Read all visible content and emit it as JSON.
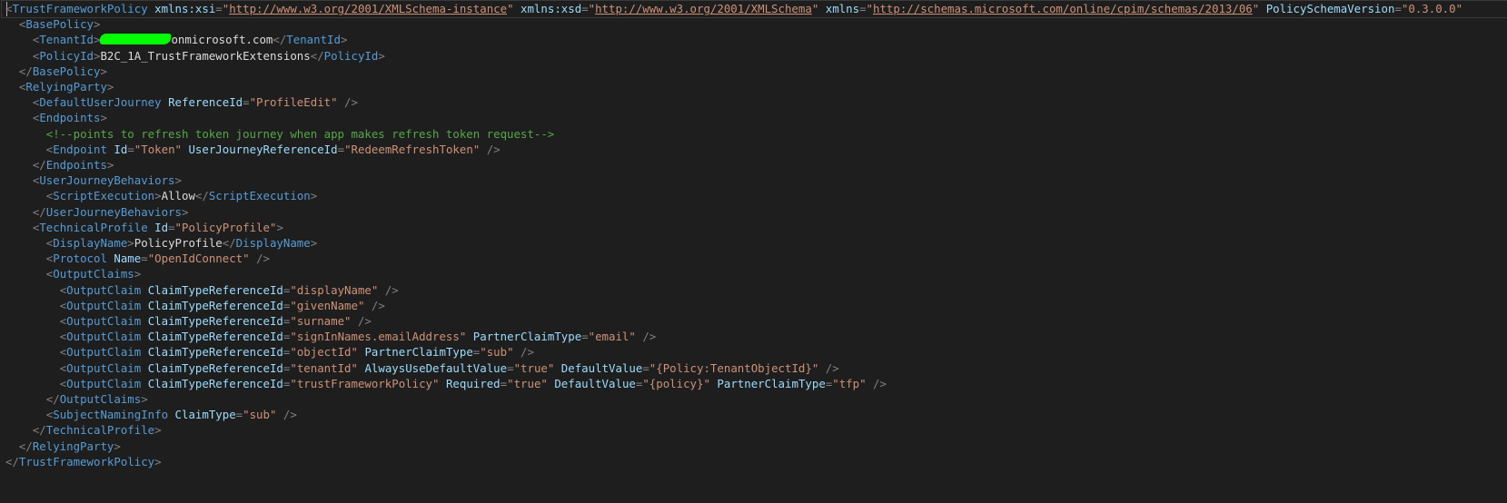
{
  "colors": {
    "background": "#1e1e1e",
    "tag": "#569cd6",
    "punctuation": "#808080",
    "attribute": "#9cdcfe",
    "string": "#ce9178",
    "text": "#dcdcdc",
    "comment": "#57a64a",
    "redaction": "#00ff00"
  },
  "lines": [
    {
      "indent": 0,
      "tokens": [
        {
          "t": "punc",
          "v": "<"
        },
        {
          "t": "tag",
          "v": "TrustFrameworkPolicy"
        },
        {
          "t": "text",
          "v": " "
        },
        {
          "t": "attr",
          "v": "xmlns:xsi"
        },
        {
          "t": "punc",
          "v": "="
        },
        {
          "t": "str",
          "v": "\""
        },
        {
          "t": "link",
          "v": "http://www.w3.org/2001/XMLSchema-instance"
        },
        {
          "t": "str",
          "v": "\""
        },
        {
          "t": "text",
          "v": " "
        },
        {
          "t": "attr",
          "v": "xmlns:xsd"
        },
        {
          "t": "punc",
          "v": "="
        },
        {
          "t": "str",
          "v": "\""
        },
        {
          "t": "link",
          "v": "http://www.w3.org/2001/XMLSchema"
        },
        {
          "t": "str",
          "v": "\""
        },
        {
          "t": "text",
          "v": " "
        },
        {
          "t": "attr",
          "v": "xmlns"
        },
        {
          "t": "punc",
          "v": "="
        },
        {
          "t": "str",
          "v": "\""
        },
        {
          "t": "link",
          "v": "http://schemas.microsoft.com/online/cpim/schemas/2013/06"
        },
        {
          "t": "str",
          "v": "\""
        },
        {
          "t": "text",
          "v": " "
        },
        {
          "t": "attr",
          "v": "PolicySchemaVersion"
        },
        {
          "t": "punc",
          "v": "="
        },
        {
          "t": "str",
          "v": "\"0.3.0.0\""
        }
      ]
    },
    {
      "indent": 1,
      "tokens": [
        {
          "t": "punc",
          "v": "<"
        },
        {
          "t": "tag",
          "v": "BasePolicy"
        },
        {
          "t": "punc",
          "v": ">"
        }
      ]
    },
    {
      "indent": 2,
      "tokens": [
        {
          "t": "punc",
          "v": "<"
        },
        {
          "t": "tag",
          "v": "TenantId"
        },
        {
          "t": "punc",
          "v": ">"
        },
        {
          "t": "redacted",
          "v": ""
        },
        {
          "t": "text",
          "v": "onmicrosoft.com"
        },
        {
          "t": "punc",
          "v": "</"
        },
        {
          "t": "tag",
          "v": "TenantId"
        },
        {
          "t": "punc",
          "v": ">"
        }
      ]
    },
    {
      "indent": 2,
      "tokens": [
        {
          "t": "punc",
          "v": "<"
        },
        {
          "t": "tag",
          "v": "PolicyId"
        },
        {
          "t": "punc",
          "v": ">"
        },
        {
          "t": "text",
          "v": "B2C_1A_TrustFrameworkExtensions"
        },
        {
          "t": "punc",
          "v": "</"
        },
        {
          "t": "tag",
          "v": "PolicyId"
        },
        {
          "t": "punc",
          "v": ">"
        }
      ]
    },
    {
      "indent": 1,
      "tokens": [
        {
          "t": "punc",
          "v": "</"
        },
        {
          "t": "tag",
          "v": "BasePolicy"
        },
        {
          "t": "punc",
          "v": ">"
        }
      ]
    },
    {
      "indent": 1,
      "tokens": [
        {
          "t": "punc",
          "v": "<"
        },
        {
          "t": "tag",
          "v": "RelyingParty"
        },
        {
          "t": "punc",
          "v": ">"
        }
      ]
    },
    {
      "indent": 2,
      "tokens": [
        {
          "t": "punc",
          "v": "<"
        },
        {
          "t": "tag",
          "v": "DefaultUserJourney"
        },
        {
          "t": "text",
          "v": " "
        },
        {
          "t": "attr",
          "v": "ReferenceId"
        },
        {
          "t": "punc",
          "v": "="
        },
        {
          "t": "str",
          "v": "\"ProfileEdit\""
        },
        {
          "t": "text",
          "v": " "
        },
        {
          "t": "punc",
          "v": "/>"
        }
      ]
    },
    {
      "indent": 2,
      "tokens": [
        {
          "t": "punc",
          "v": "<"
        },
        {
          "t": "tag",
          "v": "Endpoints"
        },
        {
          "t": "punc",
          "v": ">"
        }
      ]
    },
    {
      "indent": 3,
      "tokens": [
        {
          "t": "comment",
          "v": "<!--points to refresh token journey when app makes refresh token request-->"
        }
      ]
    },
    {
      "indent": 3,
      "tokens": [
        {
          "t": "punc",
          "v": "<"
        },
        {
          "t": "tag",
          "v": "Endpoint"
        },
        {
          "t": "text",
          "v": " "
        },
        {
          "t": "attr",
          "v": "Id"
        },
        {
          "t": "punc",
          "v": "="
        },
        {
          "t": "str",
          "v": "\"Token\""
        },
        {
          "t": "text",
          "v": " "
        },
        {
          "t": "attr",
          "v": "UserJourneyReferenceId"
        },
        {
          "t": "punc",
          "v": "="
        },
        {
          "t": "str",
          "v": "\"RedeemRefreshToken\""
        },
        {
          "t": "text",
          "v": " "
        },
        {
          "t": "punc",
          "v": "/>"
        }
      ]
    },
    {
      "indent": 2,
      "tokens": [
        {
          "t": "punc",
          "v": "</"
        },
        {
          "t": "tag",
          "v": "Endpoints"
        },
        {
          "t": "punc",
          "v": ">"
        }
      ]
    },
    {
      "indent": 2,
      "tokens": [
        {
          "t": "punc",
          "v": "<"
        },
        {
          "t": "tag",
          "v": "UserJourneyBehaviors"
        },
        {
          "t": "punc",
          "v": ">"
        }
      ]
    },
    {
      "indent": 3,
      "tokens": [
        {
          "t": "punc",
          "v": "<"
        },
        {
          "t": "tag",
          "v": "ScriptExecution"
        },
        {
          "t": "punc",
          "v": ">"
        },
        {
          "t": "text",
          "v": "Allow"
        },
        {
          "t": "punc",
          "v": "</"
        },
        {
          "t": "tag",
          "v": "ScriptExecution"
        },
        {
          "t": "punc",
          "v": ">"
        }
      ]
    },
    {
      "indent": 2,
      "tokens": [
        {
          "t": "punc",
          "v": "</"
        },
        {
          "t": "tag",
          "v": "UserJourneyBehaviors"
        },
        {
          "t": "punc",
          "v": ">"
        }
      ]
    },
    {
      "indent": 2,
      "tokens": [
        {
          "t": "punc",
          "v": "<"
        },
        {
          "t": "tag",
          "v": "TechnicalProfile"
        },
        {
          "t": "text",
          "v": " "
        },
        {
          "t": "attr",
          "v": "Id"
        },
        {
          "t": "punc",
          "v": "="
        },
        {
          "t": "str",
          "v": "\"PolicyProfile\""
        },
        {
          "t": "punc",
          "v": ">"
        }
      ]
    },
    {
      "indent": 3,
      "tokens": [
        {
          "t": "punc",
          "v": "<"
        },
        {
          "t": "tag",
          "v": "DisplayName"
        },
        {
          "t": "punc",
          "v": ">"
        },
        {
          "t": "text",
          "v": "PolicyProfile"
        },
        {
          "t": "punc",
          "v": "</"
        },
        {
          "t": "tag",
          "v": "DisplayName"
        },
        {
          "t": "punc",
          "v": ">"
        }
      ]
    },
    {
      "indent": 3,
      "tokens": [
        {
          "t": "punc",
          "v": "<"
        },
        {
          "t": "tag",
          "v": "Protocol"
        },
        {
          "t": "text",
          "v": " "
        },
        {
          "t": "attr",
          "v": "Name"
        },
        {
          "t": "punc",
          "v": "="
        },
        {
          "t": "str",
          "v": "\"OpenIdConnect\""
        },
        {
          "t": "text",
          "v": " "
        },
        {
          "t": "punc",
          "v": "/>"
        }
      ]
    },
    {
      "indent": 3,
      "tokens": [
        {
          "t": "punc",
          "v": "<"
        },
        {
          "t": "tag",
          "v": "OutputClaims"
        },
        {
          "t": "punc",
          "v": ">"
        }
      ]
    },
    {
      "indent": 4,
      "tokens": [
        {
          "t": "punc",
          "v": "<"
        },
        {
          "t": "tag",
          "v": "OutputClaim"
        },
        {
          "t": "text",
          "v": " "
        },
        {
          "t": "attr",
          "v": "ClaimTypeReferenceId"
        },
        {
          "t": "punc",
          "v": "="
        },
        {
          "t": "str",
          "v": "\"displayName\""
        },
        {
          "t": "text",
          "v": " "
        },
        {
          "t": "punc",
          "v": "/>"
        }
      ]
    },
    {
      "indent": 4,
      "tokens": [
        {
          "t": "punc",
          "v": "<"
        },
        {
          "t": "tag",
          "v": "OutputClaim"
        },
        {
          "t": "text",
          "v": " "
        },
        {
          "t": "attr",
          "v": "ClaimTypeReferenceId"
        },
        {
          "t": "punc",
          "v": "="
        },
        {
          "t": "str",
          "v": "\"givenName\""
        },
        {
          "t": "text",
          "v": " "
        },
        {
          "t": "punc",
          "v": "/>"
        }
      ]
    },
    {
      "indent": 4,
      "tokens": [
        {
          "t": "punc",
          "v": "<"
        },
        {
          "t": "tag",
          "v": "OutputClaim"
        },
        {
          "t": "text",
          "v": " "
        },
        {
          "t": "attr",
          "v": "ClaimTypeReferenceId"
        },
        {
          "t": "punc",
          "v": "="
        },
        {
          "t": "str",
          "v": "\"surname\""
        },
        {
          "t": "text",
          "v": " "
        },
        {
          "t": "punc",
          "v": "/>"
        }
      ]
    },
    {
      "indent": 4,
      "tokens": [
        {
          "t": "punc",
          "v": "<"
        },
        {
          "t": "tag",
          "v": "OutputClaim"
        },
        {
          "t": "text",
          "v": " "
        },
        {
          "t": "attr",
          "v": "ClaimTypeReferenceId"
        },
        {
          "t": "punc",
          "v": "="
        },
        {
          "t": "str",
          "v": "\"signInNames.emailAddress\""
        },
        {
          "t": "text",
          "v": " "
        },
        {
          "t": "attr",
          "v": "PartnerClaimType"
        },
        {
          "t": "punc",
          "v": "="
        },
        {
          "t": "str",
          "v": "\"email\""
        },
        {
          "t": "text",
          "v": " "
        },
        {
          "t": "punc",
          "v": "/>"
        }
      ]
    },
    {
      "indent": 4,
      "tokens": [
        {
          "t": "punc",
          "v": "<"
        },
        {
          "t": "tag",
          "v": "OutputClaim"
        },
        {
          "t": "text",
          "v": " "
        },
        {
          "t": "attr",
          "v": "ClaimTypeReferenceId"
        },
        {
          "t": "punc",
          "v": "="
        },
        {
          "t": "str",
          "v": "\"objectId\""
        },
        {
          "t": "text",
          "v": " "
        },
        {
          "t": "attr",
          "v": "PartnerClaimType"
        },
        {
          "t": "punc",
          "v": "="
        },
        {
          "t": "str",
          "v": "\"sub\""
        },
        {
          "t": "text",
          "v": " "
        },
        {
          "t": "punc",
          "v": "/>"
        }
      ]
    },
    {
      "indent": 4,
      "tokens": [
        {
          "t": "punc",
          "v": "<"
        },
        {
          "t": "tag",
          "v": "OutputClaim"
        },
        {
          "t": "text",
          "v": " "
        },
        {
          "t": "attr",
          "v": "ClaimTypeReferenceId"
        },
        {
          "t": "punc",
          "v": "="
        },
        {
          "t": "str",
          "v": "\"tenantId\""
        },
        {
          "t": "text",
          "v": " "
        },
        {
          "t": "attr",
          "v": "AlwaysUseDefaultValue"
        },
        {
          "t": "punc",
          "v": "="
        },
        {
          "t": "str",
          "v": "\"true\""
        },
        {
          "t": "text",
          "v": " "
        },
        {
          "t": "attr",
          "v": "DefaultValue"
        },
        {
          "t": "punc",
          "v": "="
        },
        {
          "t": "str",
          "v": "\"{Policy:TenantObjectId}\""
        },
        {
          "t": "text",
          "v": " "
        },
        {
          "t": "punc",
          "v": "/>"
        }
      ]
    },
    {
      "indent": 4,
      "tokens": [
        {
          "t": "punc",
          "v": "<"
        },
        {
          "t": "tag",
          "v": "OutputClaim"
        },
        {
          "t": "text",
          "v": " "
        },
        {
          "t": "attr",
          "v": "ClaimTypeReferenceId"
        },
        {
          "t": "punc",
          "v": "="
        },
        {
          "t": "str",
          "v": "\"trustFrameworkPolicy\""
        },
        {
          "t": "text",
          "v": " "
        },
        {
          "t": "attr",
          "v": "Required"
        },
        {
          "t": "punc",
          "v": "="
        },
        {
          "t": "str",
          "v": "\"true\""
        },
        {
          "t": "text",
          "v": " "
        },
        {
          "t": "attr",
          "v": "DefaultValue"
        },
        {
          "t": "punc",
          "v": "="
        },
        {
          "t": "str",
          "v": "\"{policy}\""
        },
        {
          "t": "text",
          "v": " "
        },
        {
          "t": "attr",
          "v": "PartnerClaimType"
        },
        {
          "t": "punc",
          "v": "="
        },
        {
          "t": "str",
          "v": "\"tfp\""
        },
        {
          "t": "text",
          "v": " "
        },
        {
          "t": "punc",
          "v": "/>"
        }
      ]
    },
    {
      "indent": 3,
      "tokens": [
        {
          "t": "punc",
          "v": "</"
        },
        {
          "t": "tag",
          "v": "OutputClaims"
        },
        {
          "t": "punc",
          "v": ">"
        }
      ]
    },
    {
      "indent": 3,
      "tokens": [
        {
          "t": "punc",
          "v": "<"
        },
        {
          "t": "tag",
          "v": "SubjectNamingInfo"
        },
        {
          "t": "text",
          "v": " "
        },
        {
          "t": "attr",
          "v": "ClaimType"
        },
        {
          "t": "punc",
          "v": "="
        },
        {
          "t": "str",
          "v": "\"sub\""
        },
        {
          "t": "text",
          "v": " "
        },
        {
          "t": "punc",
          "v": "/>"
        }
      ]
    },
    {
      "indent": 2,
      "tokens": [
        {
          "t": "punc",
          "v": "</"
        },
        {
          "t": "tag",
          "v": "TechnicalProfile"
        },
        {
          "t": "punc",
          "v": ">"
        }
      ]
    },
    {
      "indent": 1,
      "tokens": [
        {
          "t": "punc",
          "v": "</"
        },
        {
          "t": "tag",
          "v": "RelyingParty"
        },
        {
          "t": "punc",
          "v": ">"
        }
      ]
    },
    {
      "indent": 0,
      "tokens": [
        {
          "t": "punc",
          "v": "</"
        },
        {
          "t": "tag",
          "v": "TrustFrameworkPolicy"
        },
        {
          "t": "punc",
          "v": ">"
        }
      ]
    }
  ]
}
